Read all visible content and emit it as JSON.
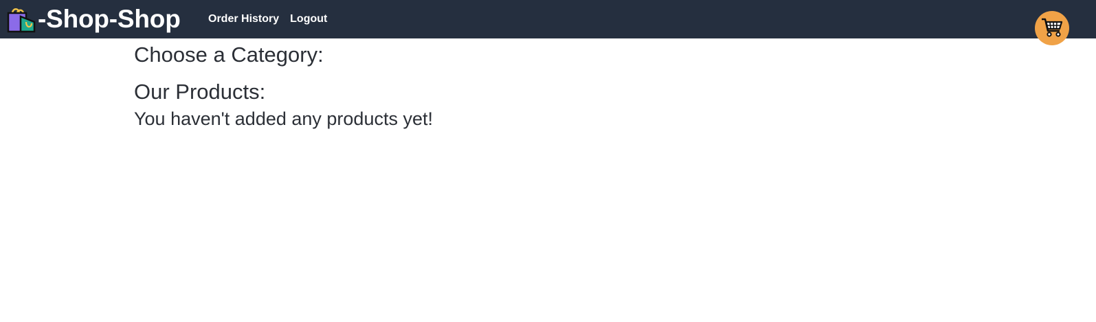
{
  "header": {
    "brand": {
      "icon": "shopping-bag-icon",
      "text": "-Shop-Shop"
    },
    "nav": {
      "order_history": "Order History",
      "logout": "Logout"
    },
    "cart": {
      "icon": "shopping-cart-icon"
    }
  },
  "main": {
    "category_heading": "Choose a Category:",
    "products_heading": "Our Products:",
    "empty_message": "You haven't added any products yet!"
  },
  "colors": {
    "header_bg": "#252f3f",
    "cart_button_bg": "#f0a247",
    "text": "#2b2f36"
  }
}
